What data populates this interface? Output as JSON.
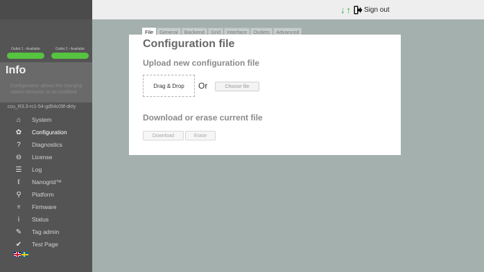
{
  "topbar": {
    "sort_icon": "sort-arrows-icon",
    "signout_icon": "sign-out-icon",
    "signout_label": "Sign out"
  },
  "sidebar": {
    "outlets": [
      {
        "label": "Outlet 1 - Available",
        "color": "#56c341"
      },
      {
        "label": "Outlet 2 - Available",
        "color": "#56c341"
      }
    ],
    "info_title": "Info",
    "info_description": "Configuration allows the charging station behavior to be modified.",
    "version": "ccu_R3.3-rc1-54-gd54c09f-dirty",
    "nav": [
      {
        "label": "System",
        "icon": "home-icon",
        "glyph": "⌂",
        "active": false
      },
      {
        "label": "Configuration",
        "icon": "gear-icon",
        "glyph": "✿",
        "active": true
      },
      {
        "label": "Diagnostics",
        "icon": "question-icon",
        "glyph": "?",
        "active": false
      },
      {
        "label": "License",
        "icon": "lock-icon",
        "glyph": "⊖",
        "active": false
      },
      {
        "label": "Log",
        "icon": "list-icon",
        "glyph": "☰",
        "active": false
      },
      {
        "label": "Nanogrid™",
        "icon": "grid-flow-icon",
        "glyph": "ℓ",
        "active": false
      },
      {
        "label": "Platform",
        "icon": "wrench-icon",
        "glyph": "⚲",
        "active": false
      },
      {
        "label": "Firmware",
        "icon": "firmware-icon",
        "glyph": "♆",
        "active": false
      },
      {
        "label": "Status",
        "icon": "info-icon",
        "glyph": "i",
        "active": false
      },
      {
        "label": "Tag admin",
        "icon": "tag-icon",
        "glyph": "✎",
        "active": false
      },
      {
        "label": "Test Page",
        "icon": "check-icon",
        "glyph": "✔",
        "active": false
      }
    ],
    "flags": [
      "uk-flag-icon",
      "sweden-flag-icon"
    ]
  },
  "tabs": [
    {
      "label": "File",
      "active": true
    },
    {
      "label": "General",
      "active": false
    },
    {
      "label": "Backend",
      "active": false
    },
    {
      "label": "Grid",
      "active": false
    },
    {
      "label": "Interface",
      "active": false
    },
    {
      "label": "Outlets",
      "active": false
    },
    {
      "label": "Advanced",
      "active": false
    }
  ],
  "panel": {
    "title": "Configuration file",
    "upload_heading": "Upload new configuration file",
    "dropzone_label": "Drag & Drop",
    "or_label": "Or",
    "choose_file_label": "Choose file",
    "download_heading": "Download or erase current file",
    "download_label": "Download",
    "erase_label": "Erase"
  },
  "colors": {
    "accent_green": "#56c341",
    "sidebar_bg": "#545454",
    "content_bg": "#a4b0ad"
  }
}
